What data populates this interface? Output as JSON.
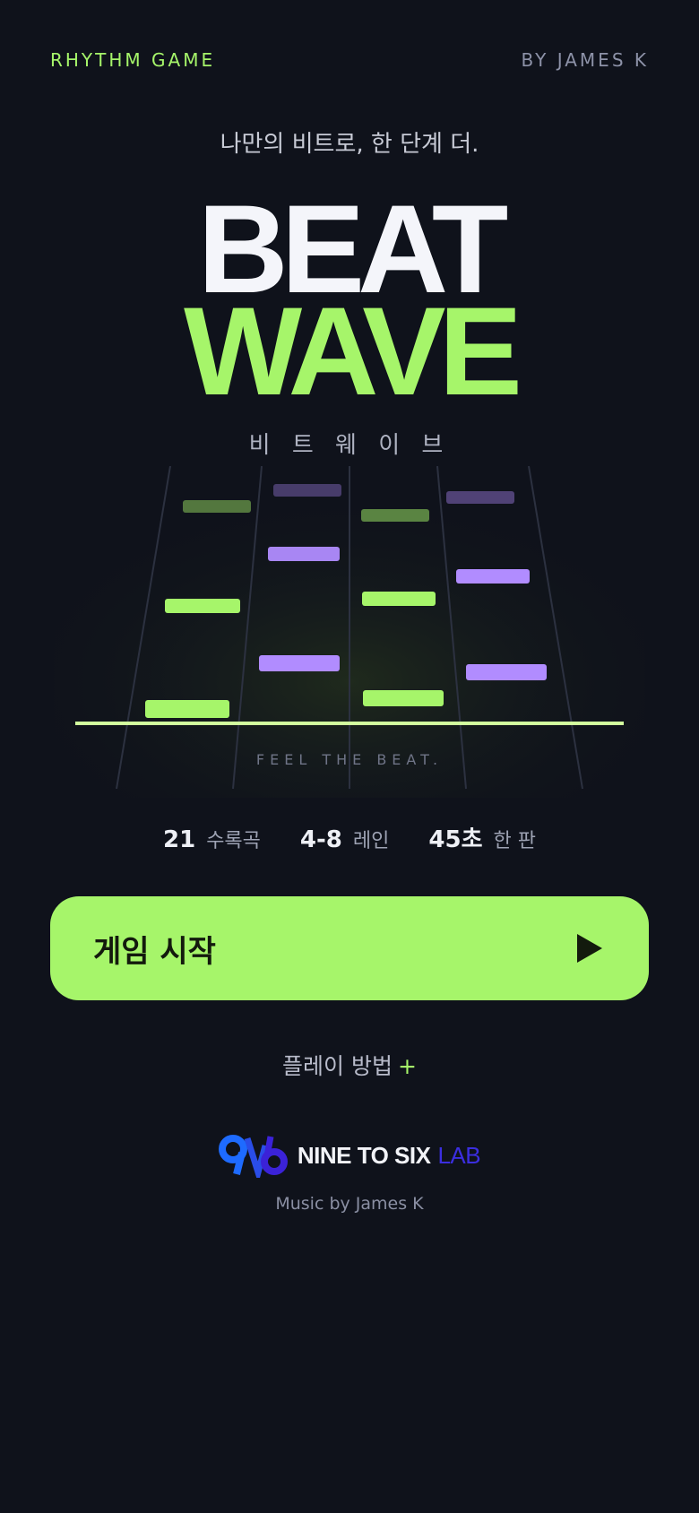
{
  "header": {
    "brand": "RHYTHM GAME",
    "author": "BY JAMES K"
  },
  "hero": {
    "tagline": "나만의 비트로, 한 단계 더.",
    "title_line1": "BEAT",
    "title_line2": "WAVE",
    "subtitle": "비 트 웨 이 브"
  },
  "visual": {
    "caption": "FEEL THE BEAT.",
    "colors": {
      "green": "#a6f56a",
      "purple": "#b18cff",
      "hit_line": "#d2ff9e"
    }
  },
  "stats": [
    {
      "value": "21",
      "label": "수록곡"
    },
    {
      "value": "4-8",
      "label": "레인"
    },
    {
      "value": "45초",
      "label": "한 판"
    }
  ],
  "start_button": {
    "label": "게임 시작",
    "icon": "play-icon"
  },
  "howto": {
    "label": "플레이 방법",
    "icon": "+"
  },
  "footer": {
    "logo_text": "NINE TO SIX",
    "logo_suffix": "LAB",
    "credit": "Music by James K"
  },
  "colors": {
    "background": "#0f121b",
    "accent": "#a6f56a"
  }
}
